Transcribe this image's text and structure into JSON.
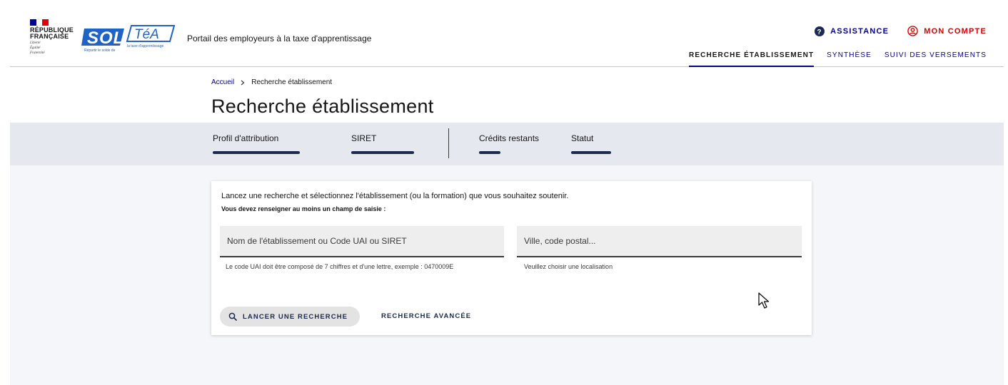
{
  "header": {
    "republic_line1": "RÉPUBLIQUE",
    "republic_line2": "FRANÇAISE",
    "motto": [
      "Liberté",
      "Égalité",
      "Fraternité"
    ],
    "logo_text": "SOLTéA",
    "logo_sub_left": "Répartir le solde de",
    "logo_sub_right": "la taxe d'apprentissage",
    "portal_title": "Portail des employeurs à la taxe d'apprentissage",
    "assistance_label": "ASSISTANCE",
    "account_label": "MON COMPTE",
    "nav": [
      {
        "label": "RECHERCHE ÉTABLISSEMENT",
        "active": true
      },
      {
        "label": "SYNTHÈSE",
        "active": false
      },
      {
        "label": "SUIVI DES VERSEMENTS",
        "active": false
      }
    ]
  },
  "breadcrumb": {
    "home": "Accueil",
    "current": "Recherche établissement"
  },
  "page_title": "Recherche établissement",
  "steps": [
    {
      "label": "Profil d'attribution"
    },
    {
      "label": "SIRET"
    },
    {
      "label": "Crédits restants"
    },
    {
      "label": "Statut"
    }
  ],
  "search_form": {
    "intro": "Lancez une recherche et sélectionnez l'établissement (ou la formation) que vous souhaitez soutenir.",
    "requirement": "Vous devez renseigner au moins un champ de saisie :",
    "name_field": {
      "placeholder": "Nom de l'établissement ou Code UAI ou SIRET",
      "value": "",
      "hint": "Le code UAI doit être composé de 7 chiffres et d'une lettre, exemple : 0470009E"
    },
    "city_field": {
      "placeholder": "Ville, code postal...",
      "value": "",
      "hint": "Veuillez choisir une localisation"
    },
    "search_button": "LANCER UNE RECHERCHE",
    "advanced_button": "RECHERCHE AVANCÉE"
  },
  "colors": {
    "blue_france": "#000091",
    "red_marianne": "#e1000f",
    "account_red": "#ce0500",
    "step_bar": "#1b2a4e",
    "band_bg": "#e5e8ef",
    "content_bg": "#f5f6fa"
  },
  "icons": {
    "assistance": "question-circle-icon",
    "account": "user-circle-icon",
    "search": "search-icon",
    "breadcrumb_sep": "chevron-right-icon",
    "cursor": "mouse-pointer-icon"
  }
}
